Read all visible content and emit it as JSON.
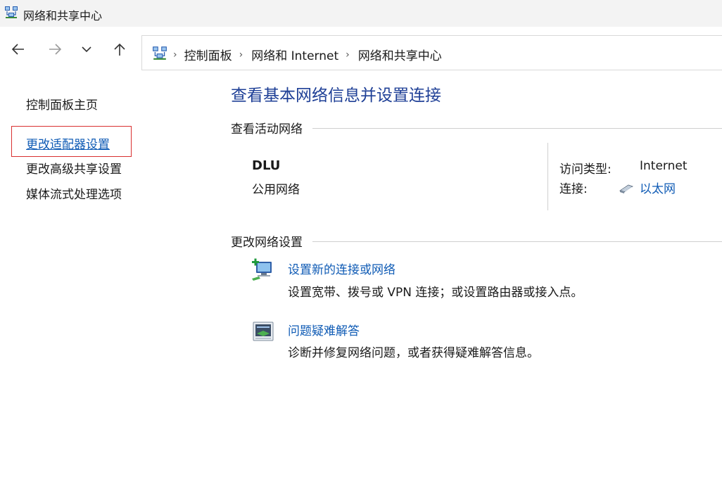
{
  "window": {
    "title": "网络和共享中心",
    "icon": "network-sharing-icon"
  },
  "nav": {
    "back_icon": "arrow-left-icon",
    "forward_icon": "arrow-right-icon",
    "recent_icon": "chevron-down-icon",
    "up_icon": "arrow-up-icon"
  },
  "address": {
    "location_icon": "network-sharing-icon",
    "breadcrumbs": [
      "控制面板",
      "网络和 Internet",
      "网络和共享中心"
    ]
  },
  "sidebar": {
    "items": [
      {
        "label": "控制面板主页"
      },
      {
        "label": "更改适配器设置",
        "highlighted": true
      },
      {
        "label": "更改高级共享设置"
      },
      {
        "label": "媒体流式处理选项"
      }
    ]
  },
  "main": {
    "title": "查看基本网络信息并设置连接",
    "active_networks": {
      "heading": "查看活动网络",
      "network_name": "DLU",
      "network_type": "公用网络",
      "access_type_label": "访问类型:",
      "access_type_value": "Internet",
      "connection_label": "连接:",
      "connection_value": "以太网",
      "connection_icon": "ethernet-icon"
    },
    "change_settings": {
      "heading": "更改网络设置",
      "tasks": [
        {
          "icon": "new-connection-icon",
          "link": "设置新的连接或网络",
          "desc": "设置宽带、拨号或 VPN 连接；或设置路由器或接入点。"
        },
        {
          "icon": "troubleshoot-icon",
          "link": "问题疑难解答",
          "desc": "诊断并修复网络问题，或者获得疑难解答信息。"
        }
      ]
    }
  },
  "colors": {
    "link": "#0f5bb5",
    "title": "#1e3f96",
    "highlight": "#d93030"
  }
}
